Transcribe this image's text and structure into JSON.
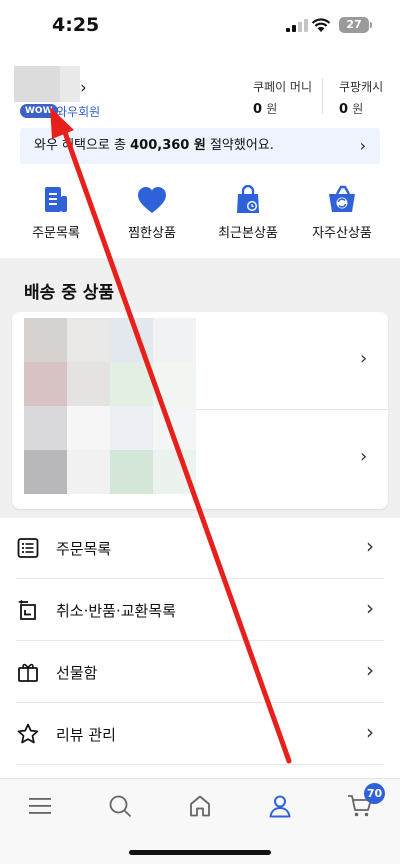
{
  "status_bar": {
    "time": "4:25",
    "battery": "27"
  },
  "profile": {
    "membership_badge": "WOW",
    "membership_label": "와우회원",
    "name_chevron": "›"
  },
  "balances": [
    {
      "label": "쿠페이 머니",
      "amount": "0",
      "unit": "원"
    },
    {
      "label": "쿠팡캐시",
      "amount": "0",
      "unit": "원"
    }
  ],
  "savings_banner": {
    "prefix": "와우 혜택으로 총 ",
    "amount": "400,360 원",
    "suffix": " 절약했어요.",
    "chevron": "›"
  },
  "shortcuts": [
    {
      "label": "주문목록",
      "icon": "order-list-icon"
    },
    {
      "label": "찜한상품",
      "icon": "heart-icon"
    },
    {
      "label": "최근본상품",
      "icon": "recent-bag-icon"
    },
    {
      "label": "자주산상품",
      "icon": "repurchase-basket-icon"
    }
  ],
  "shipping_section": {
    "title": "배송 중 상품",
    "chevron": "›"
  },
  "menu_items": [
    {
      "label": "주문목록",
      "icon": "list-icon",
      "chevron": "›"
    },
    {
      "label": "취소·반품·교환목록",
      "icon": "return-icon",
      "chevron": "›"
    },
    {
      "label": "선물함",
      "icon": "gift-icon",
      "chevron": "›"
    },
    {
      "label": "리뷰 관리",
      "icon": "star-icon",
      "chevron": "›"
    }
  ],
  "tab_bar": {
    "tabs": [
      "menu-icon",
      "search-icon",
      "home-icon",
      "my-page-icon",
      "cart-icon"
    ],
    "active": "my-page-icon",
    "cart_count": "70"
  },
  "colors": {
    "accent": "#2f62d8",
    "wow_badge": "#3c62c8",
    "banner_bg": "#eef3fd",
    "annotation_arrow": "#e8201c"
  }
}
